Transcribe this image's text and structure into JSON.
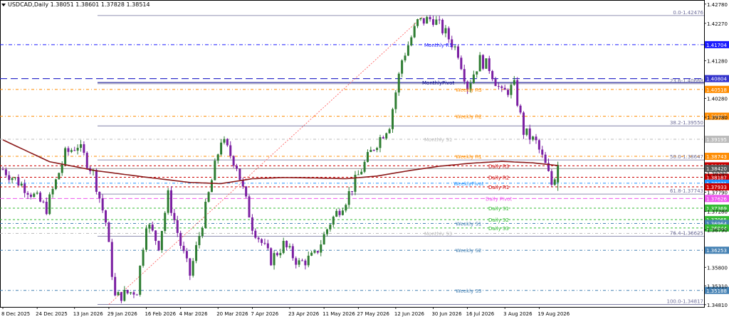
{
  "header": {
    "symbol_line": "USDCAD,Daily  1.38051 1.38601 1.37828 1.38514"
  },
  "colors": {
    "bull_candle": "#2e7d32",
    "bear_candle": "#7b1fa2",
    "moving_average": "#8b1a1a",
    "fib_line": "#6d6d9a",
    "monthly_r1": "#1a1aff",
    "monthly_pivot": "#00008b",
    "weekly_resistance": "#ff8c00",
    "monthly_s1": "#bbbbbb",
    "daily_resistance": "#cc0000",
    "weekly_pivot": "#1e90ff",
    "daily_pivot": "#ee55ee",
    "daily_support": "#33bb33",
    "weekly_support": "#4682b4",
    "axis_text": "#000000",
    "current_price": "#555555"
  },
  "chart_data": {
    "type": "candlestick",
    "title": "USDCAD,Daily",
    "ohlc_header": {
      "open": 1.38051,
      "high": 1.38601,
      "low": 1.37828,
      "close": 1.38514
    },
    "ylim": [
      1.3475,
      1.427
    ],
    "y_ticks": [
      "1.42780",
      "1.42270",
      "1.41280",
      "1.40280",
      "1.39780",
      "1.38280",
      "1.37790",
      "1.37280",
      "1.36790",
      "1.35800",
      "1.35310",
      "1.34810"
    ],
    "x_ticks": [
      "8 Dec 2025",
      "24 Dec 2025",
      "13 Jan 2026",
      "29 Jan 2026",
      "16 Feb 2026",
      "4 Mar 2026",
      "20 Mar 2026",
      "7 Apr 2026",
      "23 Apr 2026",
      "11 May 2026",
      "27 May 2026",
      "12 Jun 2026",
      "30 Jun 2026",
      "16 Jul 2026",
      "3 Aug 2026",
      "19 Aug 2026"
    ],
    "series": [
      {
        "name": "USDCAD",
        "type": "candlestick",
        "anchors": [
          [
            0,
            1.384
          ],
          [
            8,
            1.3786
          ],
          [
            14,
            1.3736
          ],
          [
            20,
            1.388
          ],
          [
            24,
            1.3905
          ],
          [
            29,
            1.383
          ],
          [
            33,
            1.37
          ],
          [
            36,
            1.35
          ],
          [
            43,
            1.352
          ],
          [
            46,
            1.37
          ],
          [
            50,
            1.364
          ],
          [
            53,
            1.377
          ],
          [
            57,
            1.364
          ],
          [
            60,
            1.356
          ],
          [
            64,
            1.37
          ],
          [
            70,
            1.392
          ],
          [
            75,
            1.385
          ],
          [
            80,
            1.369
          ],
          [
            86,
            1.36
          ],
          [
            90,
            1.364
          ],
          [
            95,
            1.359
          ],
          [
            100,
            1.361
          ],
          [
            105,
            1.37
          ],
          [
            110,
            1.376
          ],
          [
            115,
            1.384
          ],
          [
            119,
            1.39
          ],
          [
            124,
            1.396
          ],
          [
            128,
            1.413
          ],
          [
            133,
            1.423
          ],
          [
            138,
            1.424
          ],
          [
            142,
            1.42
          ],
          [
            146,
            1.415
          ],
          [
            149,
            1.406
          ],
          [
            153,
            1.413
          ],
          [
            156,
            1.411
          ],
          [
            160,
            1.404
          ],
          [
            164,
            1.406
          ],
          [
            167,
            1.394
          ],
          [
            171,
            1.391
          ],
          [
            174,
            1.385
          ],
          [
            176,
            1.38
          ],
          [
            178,
            1.3851
          ]
        ]
      },
      {
        "name": "",
        "type": "moving_average",
        "anchors": [
          [
            0,
            1.3918
          ],
          [
            15,
            1.386
          ],
          [
            30,
            1.3836
          ],
          [
            45,
            1.382
          ],
          [
            60,
            1.3805
          ],
          [
            70,
            1.3802
          ],
          [
            80,
            1.3815
          ],
          [
            90,
            1.3818
          ],
          [
            100,
            1.3817
          ],
          [
            110,
            1.3815
          ],
          [
            120,
            1.3822
          ],
          [
            130,
            1.3836
          ],
          [
            140,
            1.3848
          ],
          [
            150,
            1.3856
          ],
          [
            160,
            1.3861
          ],
          [
            170,
            1.3857
          ],
          [
            178,
            1.385
          ]
        ]
      },
      {
        "name": "",
        "type": "fib_trendline",
        "from": [
          34,
          1.34817
        ],
        "to": [
          135,
          1.42476
        ]
      }
    ],
    "levels": [
      {
        "label": "0.0-1.42476",
        "value": 1.42476,
        "style": "fib",
        "color": "#6d6d9a",
        "badge": false
      },
      {
        "label": "Monthly R1",
        "value": 1.41704,
        "style": "monthly_r1",
        "color": "#1a1aff",
        "badge": true,
        "badge_text": "1.41704"
      },
      {
        "label": "",
        "value": 1.40804,
        "style": "dashed_blue",
        "color": "#3333cc",
        "badge": true,
        "badge_text": "1.40804"
      },
      {
        "label": "MonthlyPivot",
        "value": 1.407,
        "style": "monthly_pivot",
        "color": "#00008b",
        "badge": false
      },
      {
        "label": "23.6-1.40668",
        "value": 1.40668,
        "style": "fib",
        "color": "#6d6d9a",
        "badge": false
      },
      {
        "label": "Weekly R3",
        "value": 1.40518,
        "style": "weekly_r",
        "color": "#ff8c00",
        "badge": true,
        "badge_text": "1.40518"
      },
      {
        "label": "Weekly R2",
        "value": 1.39807,
        "style": "weekly_r",
        "color": "#ff8c00",
        "badge": true,
        "badge_text": "1.39807"
      },
      {
        "label": "38.2-1.39550",
        "value": 1.3955,
        "style": "fib",
        "color": "#6d6d9a",
        "badge": false
      },
      {
        "label": "Monthly S1",
        "value": 1.39195,
        "style": "monthly_s1",
        "color": "#bbbbbb",
        "badge": true,
        "badge_text": "1.39195"
      },
      {
        "label": "Weekly R1",
        "value": 1.38743,
        "style": "weekly_r",
        "color": "#ff8c00",
        "badge": true,
        "badge_text": "1.38743"
      },
      {
        "label": "50.0-1.38647",
        "value": 1.38647,
        "style": "fib",
        "color": "#6d6d9a",
        "badge": false
      },
      {
        "label": "Daily R3",
        "value": 1.38491,
        "style": "daily_r",
        "color": "#cc0000",
        "badge": true,
        "badge_text": "1.38491"
      },
      {
        "label": "",
        "value": 1.3842,
        "style": "current_price",
        "color": "#555555",
        "badge": true,
        "badge_text": "1.38420"
      },
      {
        "label": "Daily R2",
        "value": 1.38187,
        "style": "daily_r",
        "color": "#cc0000",
        "badge": true,
        "badge_text": "1.38187"
      },
      {
        "label": "WeeklyPivot",
        "value": 1.38031,
        "style": "weekly_pivot",
        "color": "#1e90ff",
        "badge": true,
        "badge_text": "1.38031"
      },
      {
        "label": "Daily R1",
        "value": 1.37933,
        "style": "daily_r",
        "color": "#cc0000",
        "badge": true,
        "badge_text": "1.37933"
      },
      {
        "label": "61.8-1.37743",
        "value": 1.37743,
        "style": "fib",
        "color": "#6d6d9a",
        "badge": false
      },
      {
        "label": "Daily Pivot",
        "value": 1.37626,
        "style": "daily_pivot",
        "color": "#ee55ee",
        "badge": true,
        "badge_text": "1.37626"
      },
      {
        "label": "Daily S1",
        "value": 1.37369,
        "style": "daily_s",
        "color": "#33bb33",
        "badge": true,
        "badge_text": "1.37369"
      },
      {
        "label": "Daily S2",
        "value": 1.37065,
        "style": "daily_s",
        "color": "#33bb33",
        "badge": true,
        "badge_text": "1.37065"
      },
      {
        "label": "Weekly S1",
        "value": 1.36964,
        "style": "weekly_s",
        "color": "#4682b4",
        "badge": true,
        "badge_text": "1.36964"
      },
      {
        "label": "Daily S3",
        "value": 1.36844,
        "style": "daily_s",
        "color": "#33bb33",
        "badge": true,
        "badge_text": "1.36844"
      },
      {
        "label": "Monthly S3",
        "value": 1.367,
        "style": "monthly_s1",
        "color": "#bbbbbb",
        "badge": false
      },
      {
        "label": "76.4-1.36625",
        "value": 1.36625,
        "style": "fib",
        "color": "#6d6d9a",
        "badge": false
      },
      {
        "label": "Weekly S2",
        "value": 1.36253,
        "style": "weekly_s",
        "color": "#4682b4",
        "badge": true,
        "badge_text": "1.36253"
      },
      {
        "label": "Weekly S3",
        "value": 1.35188,
        "style": "weekly_s",
        "color": "#4682b4",
        "badge": true,
        "badge_text": "1.35188"
      },
      {
        "label": "100.0-1.34817",
        "value": 1.34817,
        "style": "fib",
        "color": "#6d6d9a",
        "badge": false
      }
    ]
  }
}
